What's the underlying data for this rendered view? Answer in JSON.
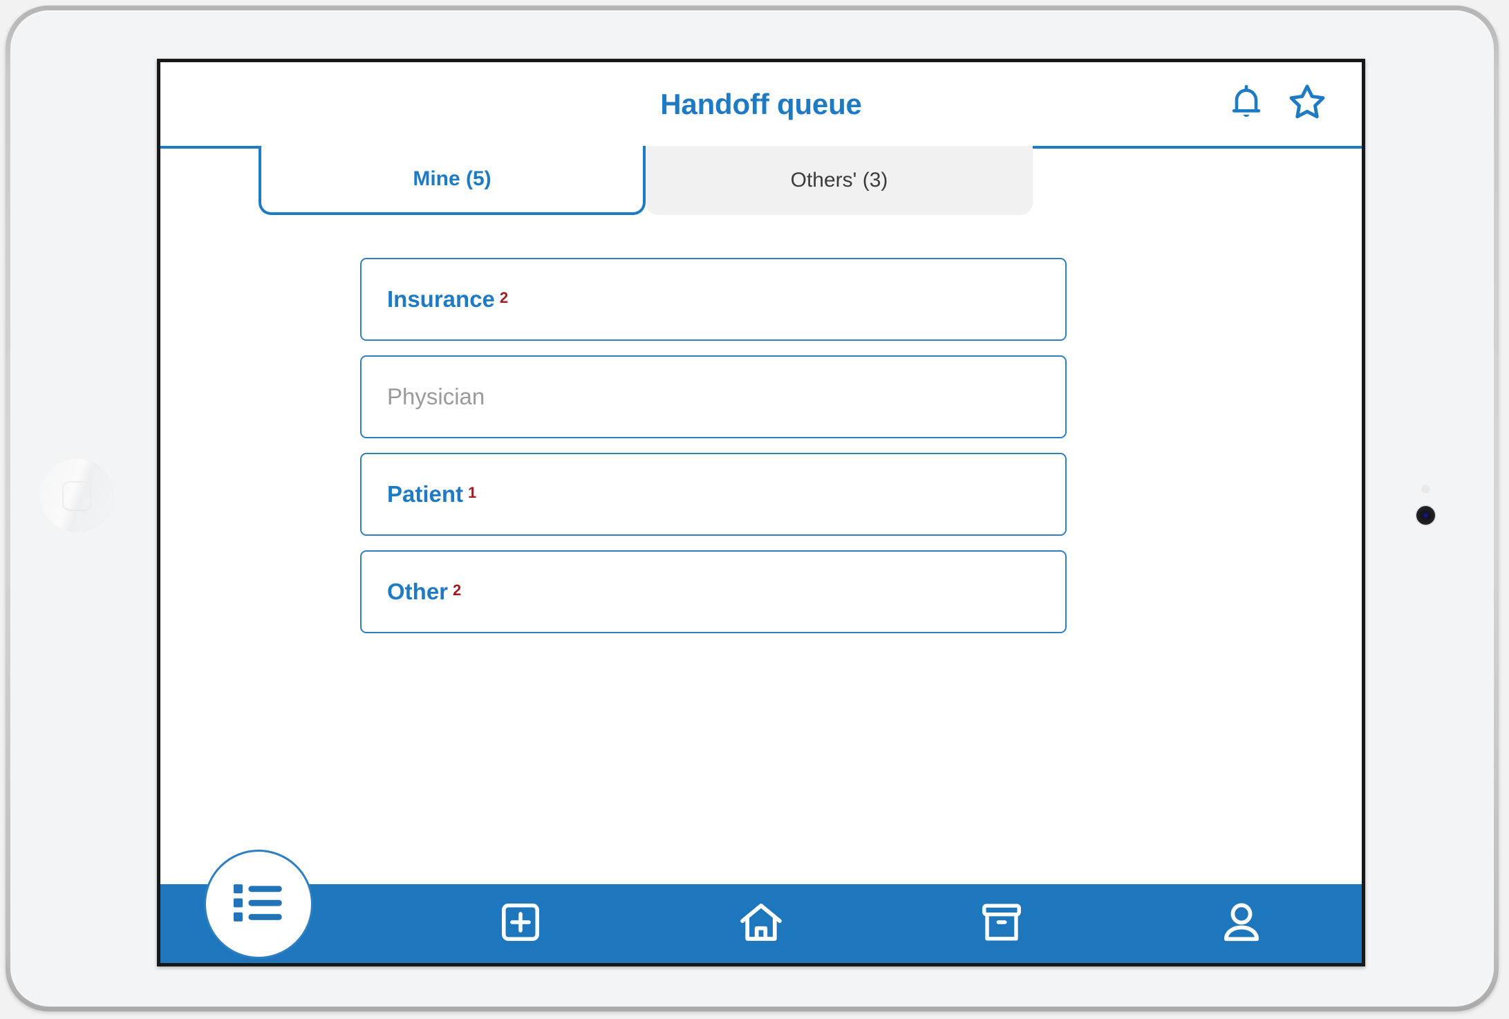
{
  "app": {
    "title": "Handoff queue",
    "accent_blue": "#1f7ac4",
    "nav_blue": "#1e76bd",
    "count_red": "#9e1b1f",
    "muted_gray": "#9a9a9a"
  },
  "header": {
    "title": "Handoff queue",
    "actions": [
      {
        "name": "notifications-icon",
        "icon": "bell-icon"
      },
      {
        "name": "favorite-icon",
        "icon": "star-icon"
      }
    ]
  },
  "tabs": [
    {
      "label": "Mine (5)",
      "active": true
    },
    {
      "label": "Others' (3)",
      "active": false
    }
  ],
  "queue": {
    "items": [
      {
        "label": "Insurance",
        "count": "2",
        "muted": false
      },
      {
        "label": "Physician",
        "count": "",
        "muted": true
      },
      {
        "label": "Patient",
        "count": "1",
        "muted": false
      },
      {
        "label": "Other",
        "count": "2",
        "muted": false
      }
    ]
  },
  "bottom_nav": {
    "fab": {
      "name": "list-fab",
      "icon": "list-icon"
    },
    "items": [
      {
        "name": "add-nav-item",
        "icon": "add-box-icon"
      },
      {
        "name": "home-nav-item",
        "icon": "home-icon"
      },
      {
        "name": "archive-nav-item",
        "icon": "archive-box-icon"
      },
      {
        "name": "profile-nav-item",
        "icon": "person-icon"
      }
    ]
  },
  "device": {
    "home_button": "home-button",
    "camera": "front-camera-lens",
    "sensor": "ambient-light-sensor"
  }
}
